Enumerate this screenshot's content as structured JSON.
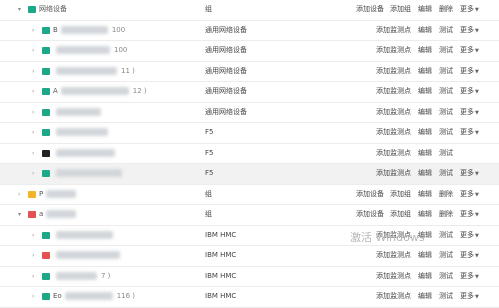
{
  "rows": [
    {
      "level": 0,
      "icon": "g",
      "name": "网络设备",
      "type": "组",
      "actions": [
        "添加设备",
        "添加组",
        "编辑",
        "删除",
        "更多"
      ],
      "hl": false
    },
    {
      "level": 1,
      "icon": "g",
      "name": "B",
      "suffix": "100",
      "type": "通用网络设备",
      "actions": [
        "添加监测点",
        "编辑",
        "测试",
        "更多"
      ],
      "hl": false
    },
    {
      "level": 1,
      "icon": "g",
      "name": "",
      "suffix": "100",
      "type": "通用网络设备",
      "actions": [
        "添加监测点",
        "编辑",
        "测试",
        "更多"
      ],
      "hl": false
    },
    {
      "level": 1,
      "icon": "g",
      "name": "",
      "suffix": "11 )",
      "type": "通用网络设备",
      "actions": [
        "添加监测点",
        "编辑",
        "测试",
        "更多"
      ],
      "hl": false
    },
    {
      "level": 1,
      "icon": "g",
      "name": "A",
      "suffix": "12 )",
      "type": "通用网络设备",
      "actions": [
        "添加监测点",
        "编辑",
        "测试",
        "更多"
      ],
      "hl": false
    },
    {
      "level": 1,
      "icon": "g",
      "name": "",
      "suffix": "",
      "type": "通用网络设备",
      "actions": [
        "添加监测点",
        "编辑",
        "测试",
        "更多"
      ],
      "hl": false
    },
    {
      "level": 1,
      "icon": "g",
      "name": "",
      "suffix": "",
      "type": "F5",
      "actions": [
        "添加监测点",
        "编辑",
        "测试",
        "更多"
      ],
      "hl": false
    },
    {
      "level": 1,
      "icon": "k",
      "name": "",
      "suffix": "",
      "type": "F5",
      "actions": [
        "添加监测点",
        "编辑",
        "测试"
      ],
      "hl": false
    },
    {
      "level": 1,
      "icon": "g",
      "name": "",
      "suffix": "",
      "type": "F5",
      "actions": [
        "添加监测点",
        "编辑",
        "测试",
        "更多"
      ],
      "hl": true
    },
    {
      "level": 0,
      "icon": "y",
      "name": "P",
      "suffix": "",
      "type": "组",
      "actions": [
        "添加设备",
        "添加组",
        "编辑",
        "删除",
        "更多"
      ],
      "hl": false
    },
    {
      "level": 0,
      "icon": "r",
      "name": "a",
      "suffix": "",
      "type": "组",
      "actions": [
        "添加设备",
        "添加组",
        "编辑",
        "删除",
        "更多"
      ],
      "hl": false
    },
    {
      "level": 1,
      "icon": "g",
      "name": "",
      "suffix": "",
      "type": "IBM HMC",
      "actions": [
        "添加监测点",
        "编辑",
        "测试",
        "更多"
      ],
      "hl": false
    },
    {
      "level": 1,
      "icon": "r",
      "name": "",
      "suffix": "",
      "type": "IBM HMC",
      "actions": [
        "添加监测点",
        "编辑",
        "测试",
        "更多"
      ],
      "hl": false
    },
    {
      "level": 1,
      "icon": "g",
      "name": "",
      "suffix": "7 )",
      "type": "IBM HMC",
      "actions": [
        "添加监测点",
        "编辑",
        "测试",
        "更多"
      ],
      "hl": false
    },
    {
      "level": 1,
      "icon": "g",
      "name": "Eo",
      "suffix": "116 )",
      "type": "IBM HMC",
      "actions": [
        "添加监测点",
        "编辑",
        "测试",
        "更多"
      ],
      "hl": false
    }
  ],
  "watermark": {
    "title": "激活 Windows"
  }
}
